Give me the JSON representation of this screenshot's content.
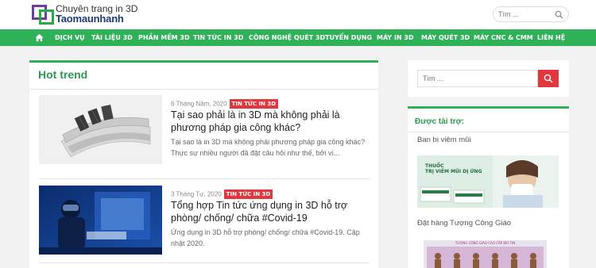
{
  "header": {
    "logo_line1": "Chuyên trang in 3D",
    "logo_line2": "Taomaunhanh",
    "search_placeholder": "Tìm ..."
  },
  "nav": {
    "items": [
      "DỊCH VỤ",
      "TÀI LIỆU 3D",
      "PHẦN MỀM 3D",
      "TIN TỨC IN 3D",
      "CÔNG NGHỆ QUÉT 3D",
      "TUYỂN DỤNG",
      "MÁY IN 3D",
      "MÁY QUÉT 3D",
      "MÁY CNC & CMM",
      "LIÊN HỆ"
    ]
  },
  "main": {
    "title": "Hot trend",
    "posts": [
      {
        "date": "6 Tháng Năm, 2020",
        "category": "TIN TỨC IN 3D",
        "title": "Tại sao phải là in 3D mà không phải là phương pháp gia công khác?",
        "excerpt": "Tại sao là in 3D mà không phải phương pháp gia công khác? Thực sự nhiều người đã đặt câu hỏi như thế, bởi vì..."
      },
      {
        "date": "3 Tháng Tư, 2020",
        "category": "TIN TỨC IN 3D",
        "title": "Tổng hợp Tin tức ứng dụng in 3D hỗ trợ phòng/ chống/ chữa #Covid-19",
        "excerpt": "Ứng dụng in 3D hỗ trợ phòng/ chống/ chữa #Covid-19. Cập nhật 2020."
      }
    ]
  },
  "sidebar": {
    "search_placeholder": "Tìm ...",
    "sponsor_title": "Được tài trợ:",
    "ads": [
      {
        "label": "Ban bị viêm mũi",
        "image_text_1": "THUỐC",
        "image_text_2": "TRỊ VIÊM MŨI DỊ ỨNG"
      },
      {
        "label": "Đặt hàng Tượng Công Giáo",
        "image_text_1": "TƯỢNG CÔNG GIÁO CAO CẤP BÌO TIN"
      }
    ]
  },
  "colors": {
    "accent_green": "#2fb158",
    "title_green": "#2a9a4e",
    "category_red": "#e2383d",
    "logo_navy": "#1e3a78",
    "logo_purple": "#6b3fa0"
  }
}
